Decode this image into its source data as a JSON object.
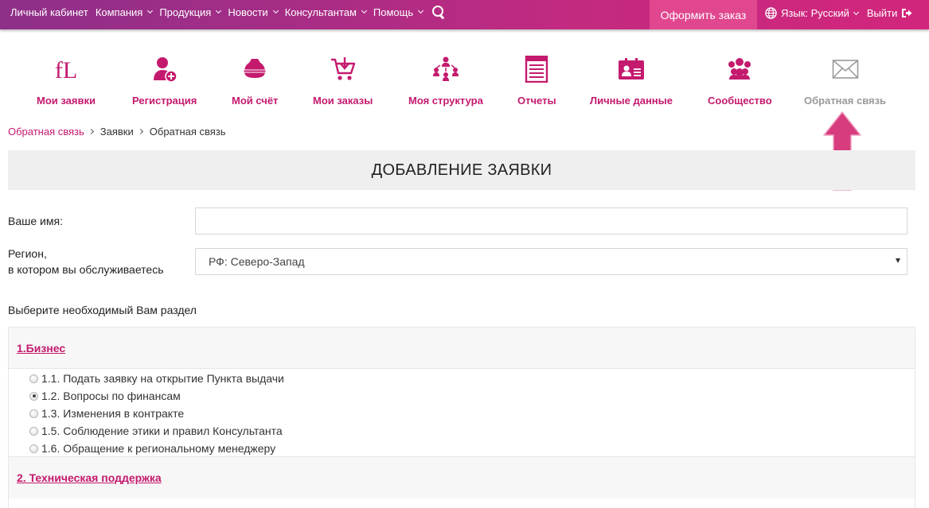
{
  "topnav": {
    "items": [
      {
        "label": "Личный кабинет",
        "dropdown": false
      },
      {
        "label": "Компания",
        "dropdown": true
      },
      {
        "label": "Продукция",
        "dropdown": true
      },
      {
        "label": "Новости",
        "dropdown": true
      },
      {
        "label": "Консультантам",
        "dropdown": true
      },
      {
        "label": "Помощь",
        "dropdown": true
      }
    ],
    "order_button": "Оформить заказ",
    "language": "Язык: Русский",
    "logout": "Выйти"
  },
  "menu": {
    "items": [
      {
        "label": "Мои заявки",
        "icon": "fl-logo-icon"
      },
      {
        "label": "Регистрация",
        "icon": "user-add-icon"
      },
      {
        "label": "Мой счёт",
        "icon": "wallet-icon"
      },
      {
        "label": "Мои заказы",
        "icon": "cart-icon"
      },
      {
        "label": "Моя структура",
        "icon": "structure-icon"
      },
      {
        "label": "Отчеты",
        "icon": "report-icon"
      },
      {
        "label": "Личные данные",
        "icon": "id-card-icon"
      },
      {
        "label": "Сообщество",
        "icon": "community-icon"
      },
      {
        "label": "Обратная связь",
        "icon": "envelope-icon"
      }
    ],
    "logo_text": "fL"
  },
  "breadcrumb": {
    "items": [
      "Обратная связь",
      "Заявки",
      "Обратная связь"
    ]
  },
  "page": {
    "title": "ДОБАВЛЕНИЕ ЗАЯВКИ"
  },
  "form": {
    "name_label": "Ваше имя:",
    "name_value": "",
    "region_label_line1": "Регион,",
    "region_label_line2": "в котором вы обслуживаетесь",
    "region_value": "РФ: Северо-Запад",
    "section_prompt": "Выберите необходимый Вам раздел"
  },
  "categories": [
    {
      "title": "1.Бизнес",
      "options": [
        {
          "label": "1.1. Подать заявку на открытие Пункта выдачи",
          "checked": false
        },
        {
          "label": "1.2. Вопросы по финансам",
          "checked": true
        },
        {
          "label": "1.3. Изменения в контракте",
          "checked": false
        },
        {
          "label": "1.5. Соблюдение этики и правил Консультанта",
          "checked": false
        },
        {
          "label": "1.6. Обращение к региональному менеджеру",
          "checked": false
        }
      ]
    },
    {
      "title": "2. Техническая поддержка",
      "options": []
    }
  ],
  "colors": {
    "brand": "#c41a6e",
    "order_button": "#e0478e",
    "arrow": "#d63c7e",
    "disabled": "#9a9a9a"
  }
}
